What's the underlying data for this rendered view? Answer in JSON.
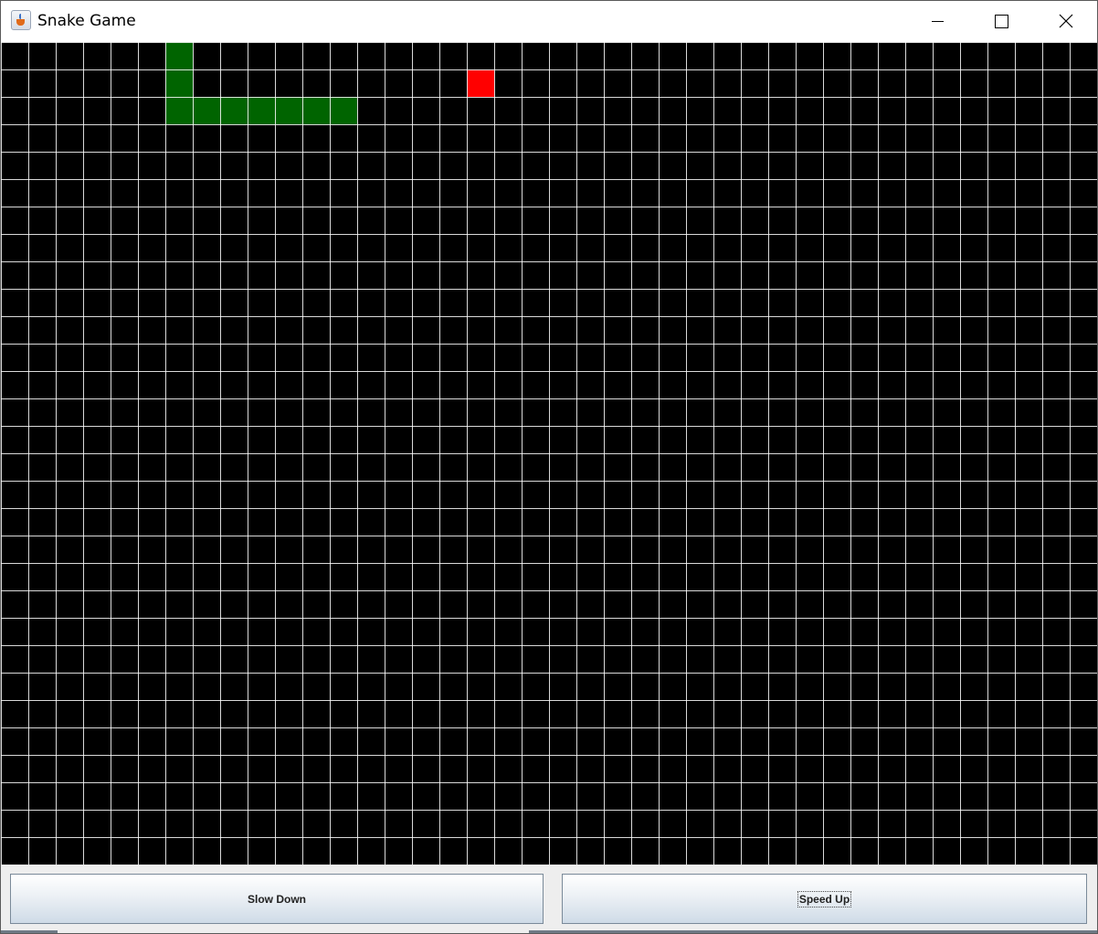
{
  "window": {
    "title": "Snake Game",
    "app_icon": "java-cup-icon",
    "buttons": [
      "minimize-icon",
      "maximize-icon",
      "close-icon"
    ]
  },
  "board": {
    "columns": 40,
    "rows": 30,
    "background_color": "#000000",
    "grid_color": "#ffffff",
    "snake_color": "#006400",
    "food_color": "#ff0000",
    "snake": [
      {
        "col": 12,
        "row": 2
      },
      {
        "col": 11,
        "row": 2
      },
      {
        "col": 10,
        "row": 2
      },
      {
        "col": 9,
        "row": 2
      },
      {
        "col": 8,
        "row": 2
      },
      {
        "col": 7,
        "row": 2
      },
      {
        "col": 6,
        "row": 2
      },
      {
        "col": 6,
        "row": 1
      },
      {
        "col": 6,
        "row": 0
      }
    ],
    "food": {
      "col": 17,
      "row": 1
    }
  },
  "controls": {
    "slow_down_label": "Slow Down",
    "speed_up_label": "Speed Up"
  }
}
